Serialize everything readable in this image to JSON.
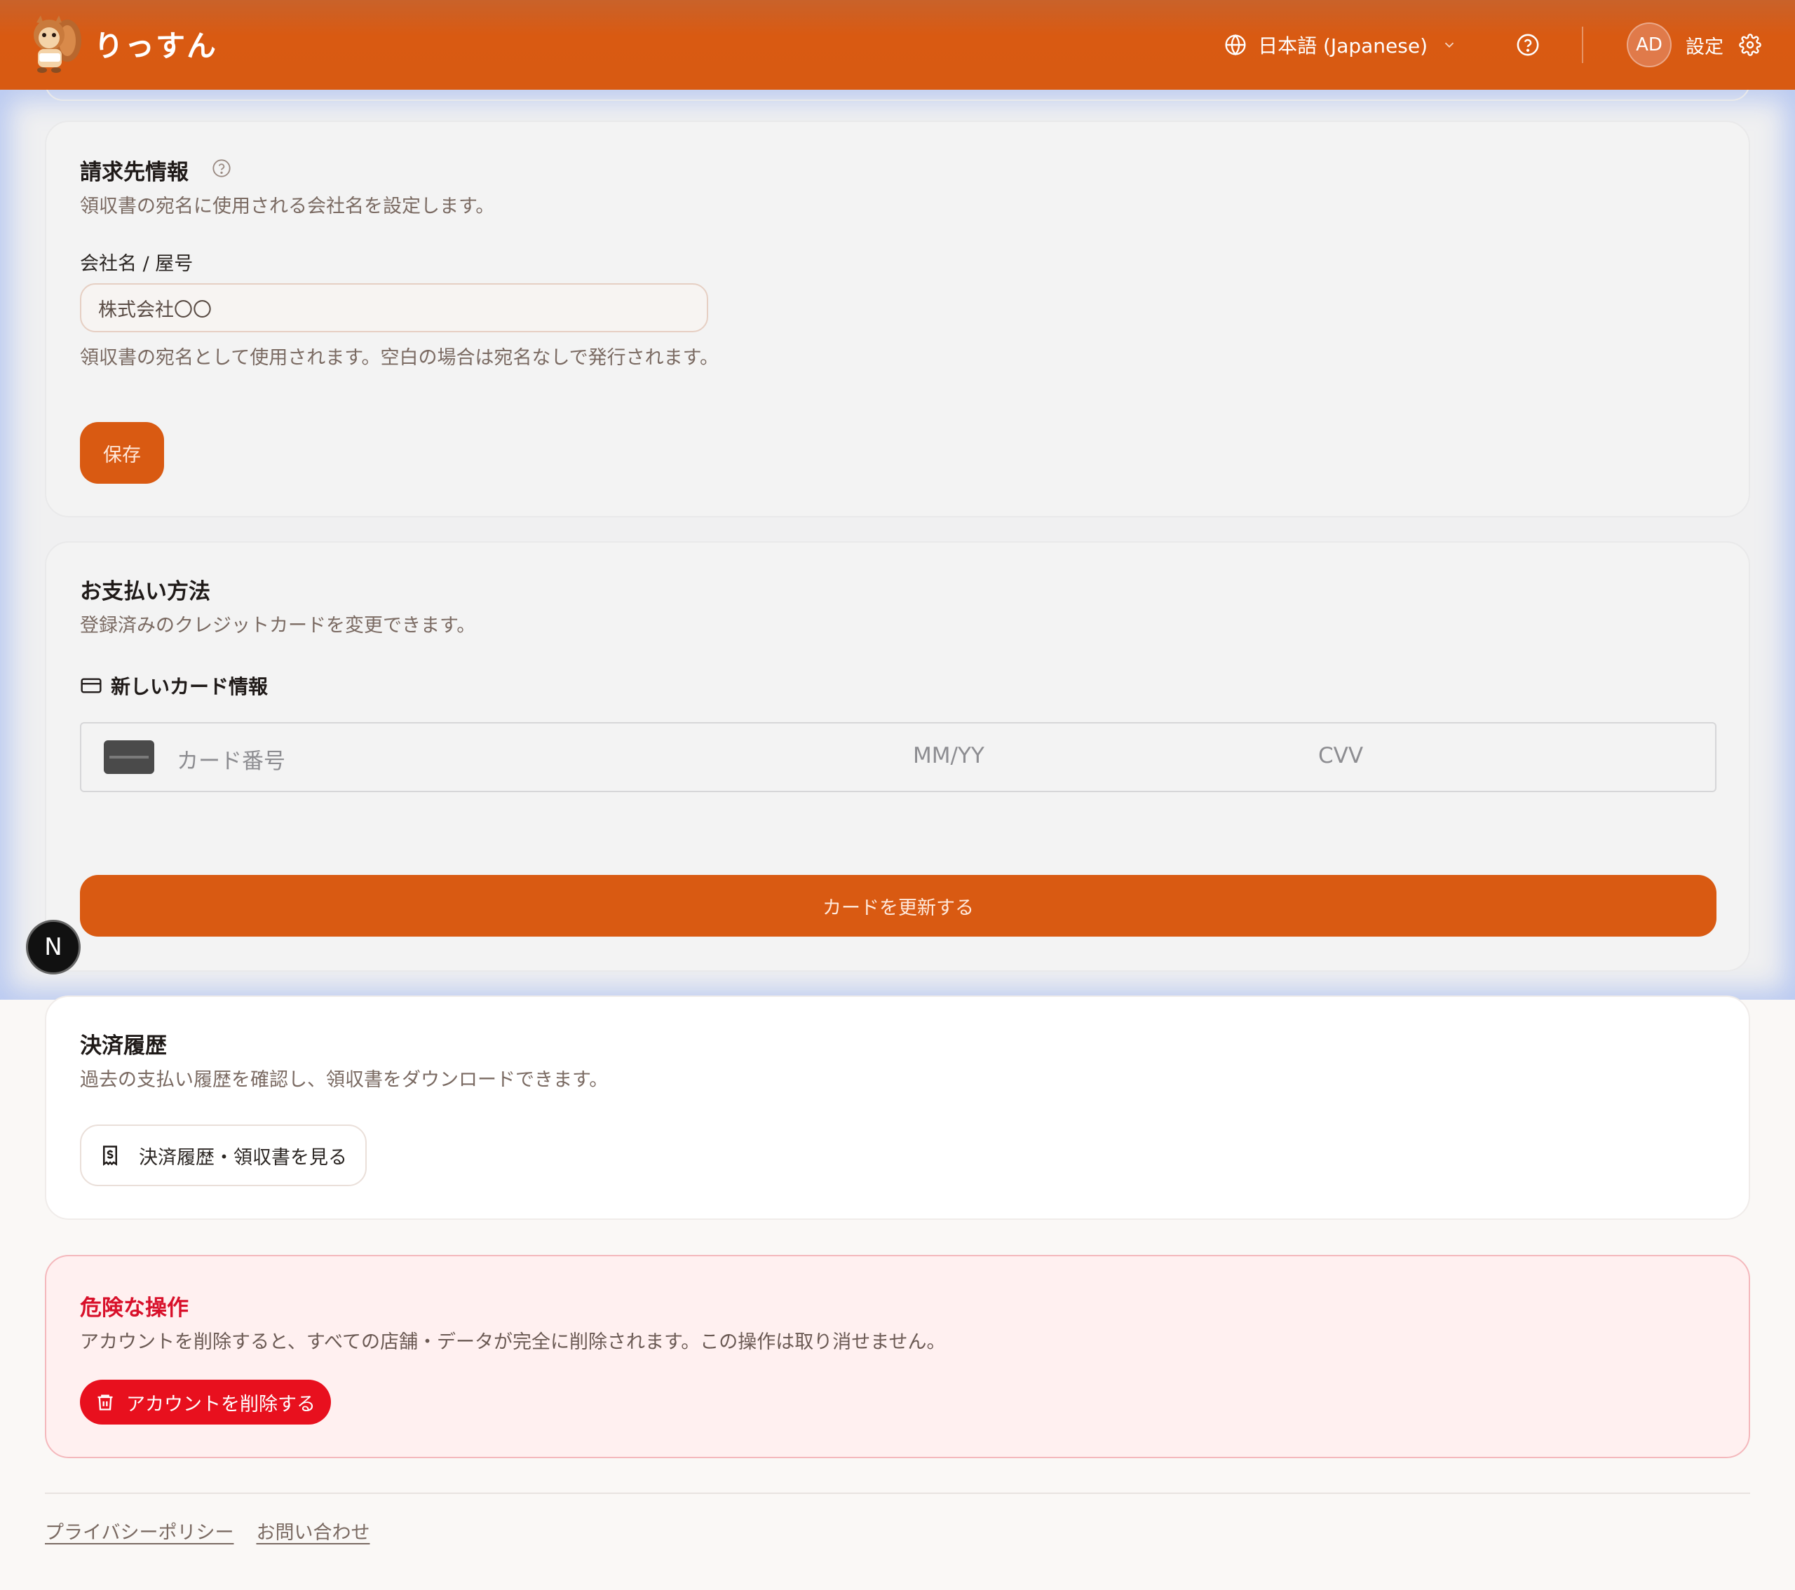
{
  "header": {
    "brand": "りっすん",
    "language": "日本語 (Japanese)",
    "avatar_initials": "AD",
    "settings_label": "設定",
    "accent_color": "#d95a12"
  },
  "billing_info": {
    "title": "請求先情報",
    "subtitle": "領収書の宛名に使用される会社名を設定します。",
    "field_label": "会社名 / 屋号",
    "field_value": "株式会社〇〇",
    "help_text": "領収書の宛名として使用されます。空白の場合は宛名なしで発行されます。",
    "save_label": "保存"
  },
  "payment_method": {
    "title": "お支払い方法",
    "subtitle": "登録済みのクレジットカードを変更できます。",
    "subhead": "新しいカード情報",
    "card_number_placeholder": "カード番号",
    "expiry_placeholder": "MM/YY",
    "cvv_placeholder": "CVV",
    "update_label": "カードを更新する"
  },
  "payment_history": {
    "title": "決済履歴",
    "subtitle": "過去の支払い履歴を確認し、領収書をダウンロードできます。",
    "button_label": "決済履歴・領収書を見る"
  },
  "danger_zone": {
    "title": "危険な操作",
    "text": "アカウントを削除すると、すべての店舗・データが完全に削除されます。この操作は取り消せません。",
    "delete_label": "アカウントを削除する",
    "danger_color": "#e8101e"
  },
  "footer": {
    "privacy": "プライバシーポリシー",
    "contact": "お問い合わせ"
  },
  "dev_badge": "N"
}
